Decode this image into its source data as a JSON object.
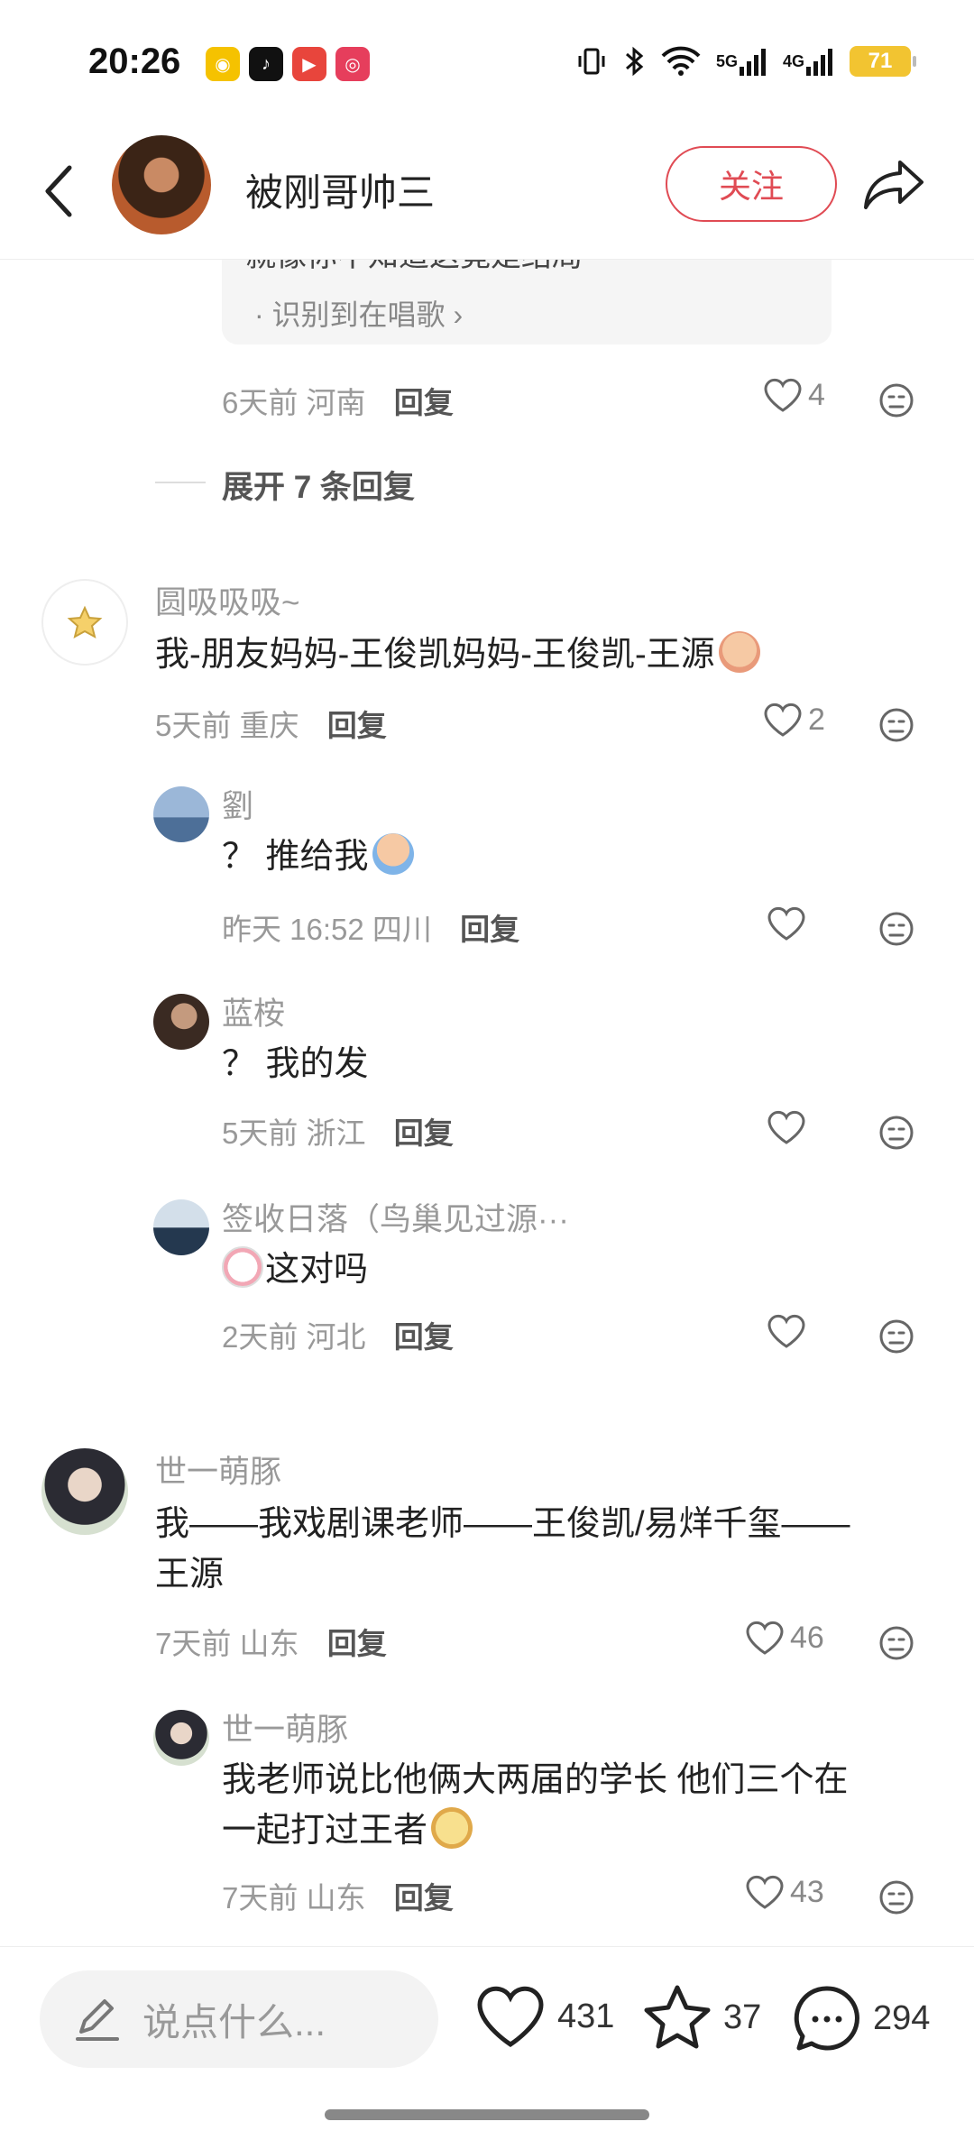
{
  "status_bar": {
    "time": "20:26",
    "net_5g": "5G",
    "net_4g": "4G",
    "battery": "71",
    "colors": {
      "battery": "#f2c431"
    }
  },
  "header": {
    "user_name": "被刚哥帅三",
    "follow_label": "关注",
    "accent_color": "#e04b54"
  },
  "quote": {
    "cut_text": "就像你不知道这竟是结局",
    "tag": "· 识别到在唱歌 ›"
  },
  "prev_reply_meta": {
    "time": "6天前",
    "location": "河南",
    "reply_label": "回复",
    "likes": "4"
  },
  "expand_label": "展开 7 条回复",
  "comments": [
    {
      "user": "圆吸吸吸~",
      "text": "我-朋友妈妈-王俊凯妈妈-王俊凯-王源",
      "time": "5天前",
      "location": "重庆",
      "reply_label": "回复",
      "likes": "2",
      "replies": [
        {
          "user": "劉",
          "text": "？ 推给我",
          "time": "昨天 16:52",
          "location": "四川",
          "reply_label": "回复",
          "likes": ""
        },
        {
          "user": "蓝桉",
          "text": "？ 我的发",
          "time": "5天前",
          "location": "浙江",
          "reply_label": "回复",
          "likes": ""
        },
        {
          "user": "签收日落（鸟巢见过源···",
          "text": "这对吗",
          "time": "2天前",
          "location": "河北",
          "reply_label": "回复",
          "likes": ""
        }
      ]
    },
    {
      "user": "世一萌豚",
      "text_line1": "我——我戏剧课老师——王俊凯/易烊千玺——",
      "text_line2": "王源",
      "time": "7天前",
      "location": "山东",
      "reply_label": "回复",
      "likes": "46",
      "replies": [
        {
          "user": "世一萌豚",
          "text_line1": "我老师说比他俩大两届的学长 他们三个在",
          "text_line2": "一起打过王者",
          "time": "7天前",
          "location": "山东",
          "reply_label": "回复",
          "likes": "43"
        }
      ]
    }
  ],
  "bottom_bar": {
    "placeholder": "说点什么...",
    "likes": "431",
    "favorites": "37",
    "comments": "294"
  }
}
